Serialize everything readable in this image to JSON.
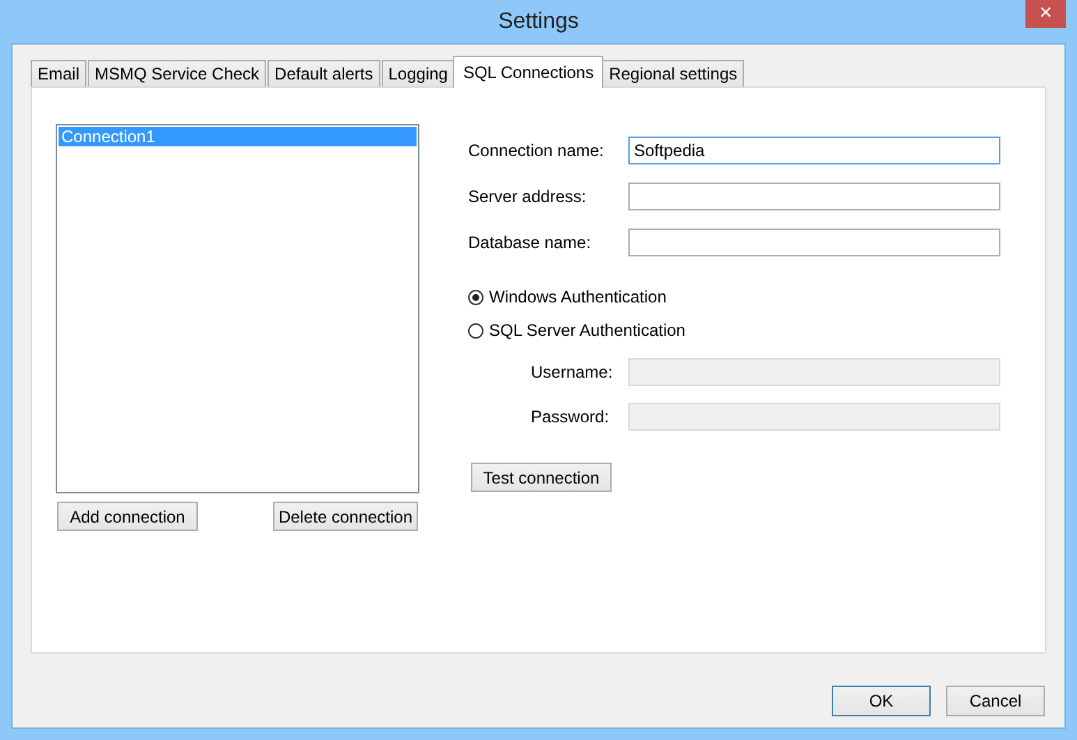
{
  "window": {
    "title": "Settings",
    "close": "×"
  },
  "tabs": [
    {
      "label": "Email",
      "selected": false
    },
    {
      "label": "MSMQ Service Check",
      "selected": false
    },
    {
      "label": "Default alerts",
      "selected": false
    },
    {
      "label": "Logging",
      "selected": false
    },
    {
      "label": "SQL Connections",
      "selected": true
    },
    {
      "label": "Regional settings",
      "selected": false
    }
  ],
  "connections": {
    "items": [
      {
        "label": "Connection1",
        "selected": true
      }
    ],
    "buttons": [
      "Add connection",
      "Delete connection"
    ]
  },
  "form": {
    "fields": [
      {
        "label": "Connection name:",
        "value": "Softpedia",
        "focused": true,
        "disabled": false
      },
      {
        "label": "Server address:",
        "focused": false,
        "disabled": false
      },
      {
        "label": "Database name:",
        "focused": false,
        "disabled": false
      }
    ],
    "auth": [
      {
        "label": "Windows Authentication",
        "selected": true
      },
      {
        "label": "SQL Server Authentication",
        "selected": false
      }
    ],
    "credentials": [
      {
        "label": "Username:",
        "focused": false,
        "disabled": true
      },
      {
        "label": "Password:",
        "focused": false,
        "disabled": true
      }
    ],
    "test_button": "Test connection"
  },
  "footer": {
    "buttons": [
      {
        "label": "OK",
        "default": true
      },
      {
        "label": "Cancel",
        "default": false
      }
    ]
  }
}
